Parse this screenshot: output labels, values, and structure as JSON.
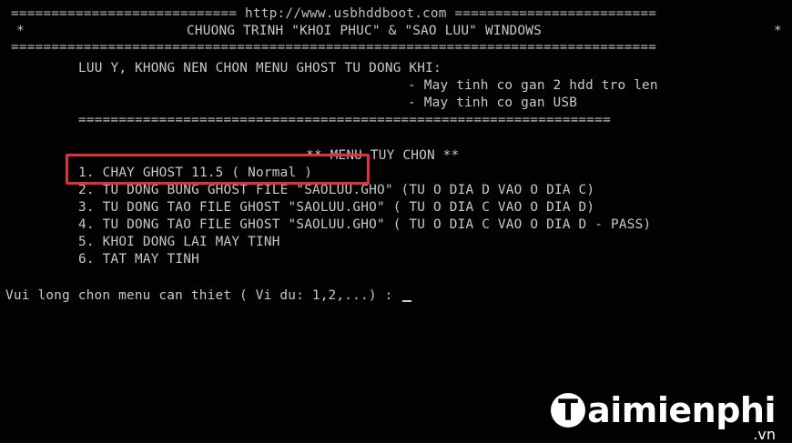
{
  "header": {
    "top_rule": "============================ http://www.usbhddboot.com =========================",
    "title_left_marker": "*",
    "title": "CHUONG TRINH \"KHOI PHUC\" & \"SAO LUU\" WINDOWS",
    "title_right_marker": "*",
    "bottom_rule": "================================================================================"
  },
  "warning": {
    "heading": "LUU Y, KHONG NEN CHON MENU GHOST TU DONG KHI:",
    "items": [
      "- May tinh co gan 2 hdd tro len",
      "- May tinh co gan USB"
    ],
    "rule": "=================================================================="
  },
  "menu": {
    "title": "** MENU TUY CHON **",
    "items": [
      {
        "label": "1. CHAY GHOST 11.5 ( Normal )"
      },
      {
        "label": "2. TU DONG BUNG GHOST FILE \"SAOLUU.GHO\" (TU O DIA D VAO O DIA C)"
      },
      {
        "label": "3. TU DONG TAO FILE GHOST \"SAOLUU.GHO\" ( TU O DIA C VAO O DIA D)"
      },
      {
        "label": "4. TU DONG TAO FILE GHOST \"SAOLUU.GHO\" ( TU O DIA C VAO O DIA D - PASS)"
      },
      {
        "label": "5. KHOI DONG LAI MAY TINH"
      },
      {
        "label": "6. TAT MAY TINH"
      }
    ]
  },
  "prompt": {
    "text": "Vui long chon menu can thiet ( Vi du: 1,2,...) : "
  },
  "watermark": {
    "logo_letter": "T",
    "text": "aimienphi",
    "sub": ".vn"
  },
  "colors": {
    "background": "#000000",
    "text": "#c8c8c8",
    "highlight": "#e0303a"
  }
}
